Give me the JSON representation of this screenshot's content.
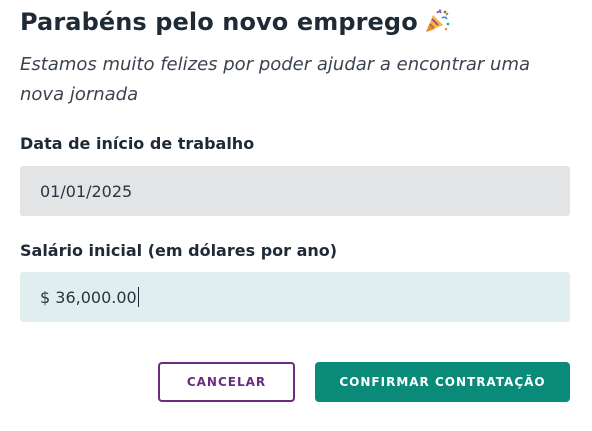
{
  "header": {
    "title": "Parabéns pelo novo emprego",
    "title_icon": "party-popper-icon",
    "subtitle": "Estamos muito felizes por poder ajudar a encontrar uma nova jornada"
  },
  "form": {
    "start_date": {
      "label": "Data de início de trabalho",
      "value": "01/01/2025"
    },
    "salary": {
      "label": "Salário inicial (em dólares por ano)",
      "value": "$ 36,000.00"
    }
  },
  "actions": {
    "cancel_label": "CANCELAR",
    "confirm_label": "CONFIRMAR CONTRATAÇÃO"
  },
  "colors": {
    "primary": "#0a8a78",
    "secondary": "#6b2c80",
    "date_field_bg": "#e3e4e6",
    "salary_field_bg": "#e1eef0"
  }
}
